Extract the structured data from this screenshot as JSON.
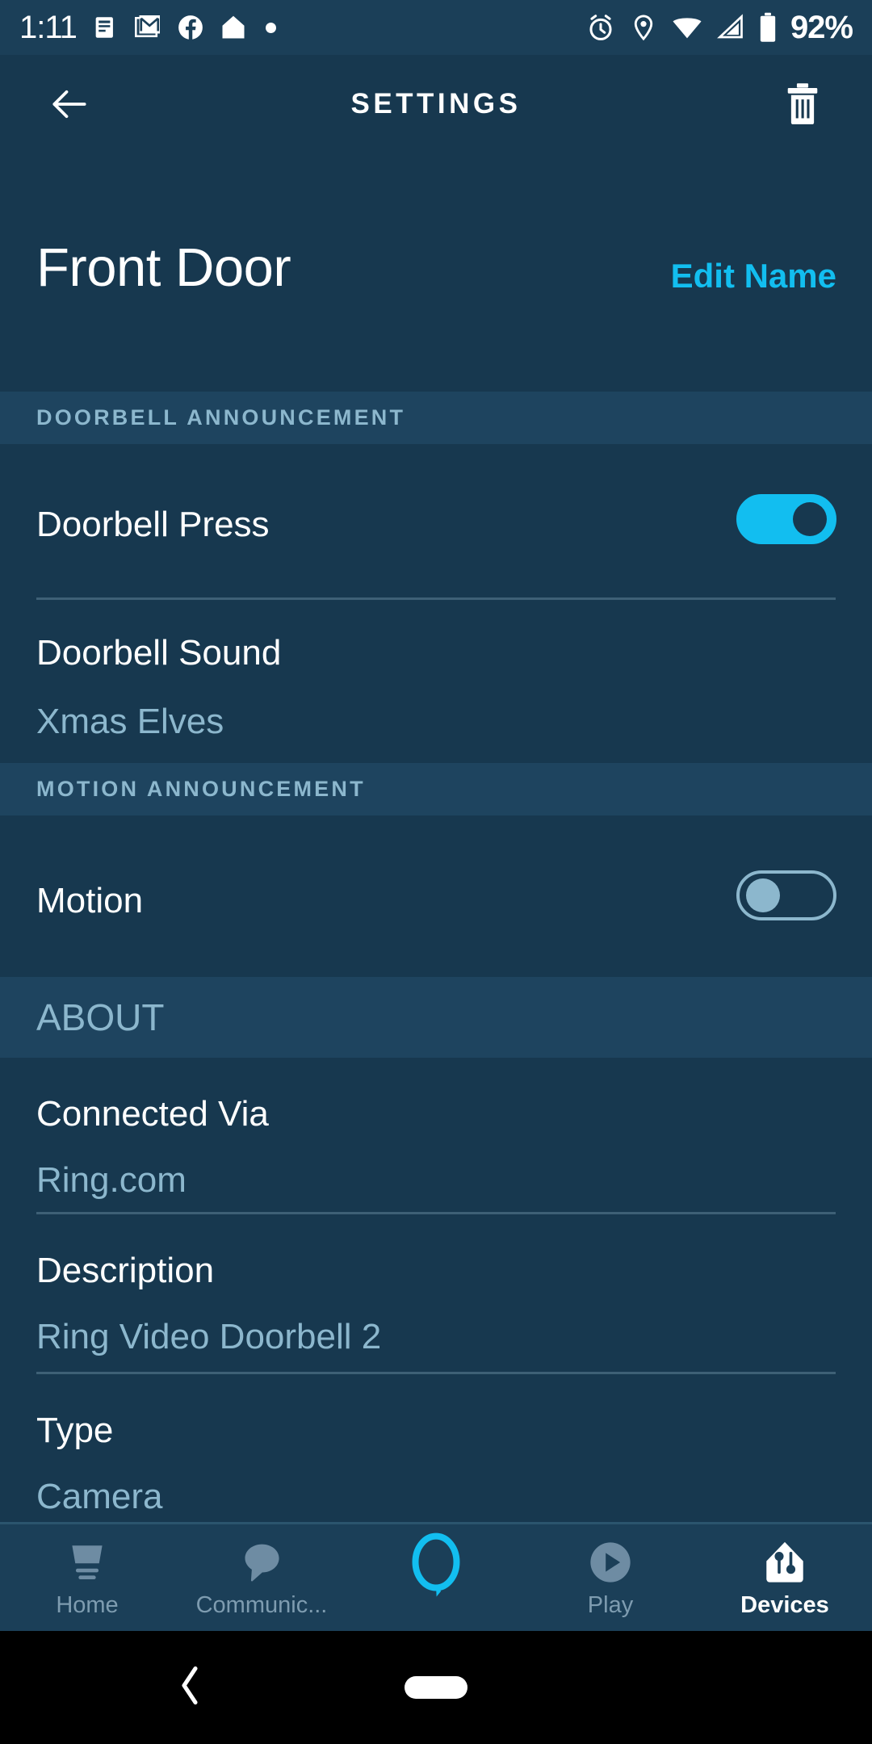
{
  "status_bar": {
    "time": "1:11",
    "battery_percent": "92%",
    "left_icons": [
      "news-icon",
      "gmail-icon",
      "facebook-icon",
      "home-icon",
      "dot-indicator-icon"
    ],
    "right_icons": [
      "alarm-icon",
      "location-icon",
      "wifi-icon",
      "cellular-signal-icon",
      "battery-icon"
    ]
  },
  "app_bar": {
    "back_icon": "arrow-left-icon",
    "title": "SETTINGS",
    "delete_icon": "trash-icon"
  },
  "device": {
    "name": "Front Door",
    "edit_name_label": "Edit Name"
  },
  "sections": [
    {
      "header": "DOORBELL ANNOUNCEMENT",
      "style": "small"
    },
    {
      "header": "MOTION ANNOUNCEMENT",
      "style": "small"
    },
    {
      "header": "ABOUT",
      "style": "large"
    }
  ],
  "rows": {
    "doorbell_press": {
      "title": "Doorbell Press",
      "toggle_state": "on"
    },
    "doorbell_sound": {
      "title": "Doorbell Sound",
      "value": "Xmas Elves"
    },
    "motion": {
      "title": "Motion",
      "toggle_state": "off"
    },
    "connected_via": {
      "title": "Connected Via",
      "value": "Ring.com"
    },
    "description": {
      "title": "Description",
      "value": "Ring Video Doorbell 2"
    },
    "type": {
      "title": "Type",
      "value": "Camera"
    }
  },
  "bottom_nav": [
    {
      "label": "Home",
      "icon": "home-nav-icon",
      "active": false
    },
    {
      "label": "Communic...",
      "icon": "chat-bubble-icon",
      "active": false
    },
    {
      "label": "",
      "icon": "alexa-ring-icon",
      "active": false
    },
    {
      "label": "Play",
      "icon": "play-circle-icon",
      "active": false
    },
    {
      "label": "Devices",
      "icon": "devices-house-icon",
      "active": true
    }
  ],
  "android_nav": {
    "back_icon": "chevron-left-icon",
    "home_pill": "home-pill-icon"
  },
  "colors": {
    "background": "#17384f",
    "section_band": "#1e445f",
    "accent": "#12bef0",
    "muted_text": "#8cb7cd",
    "divider": "#3e6076"
  }
}
